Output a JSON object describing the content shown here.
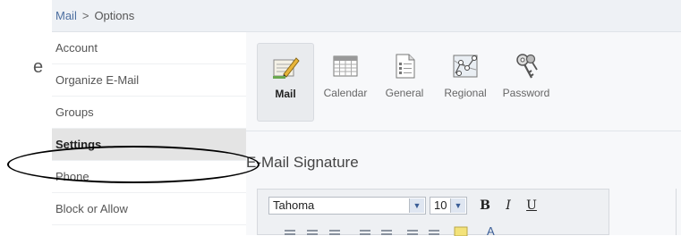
{
  "stray_text": "e",
  "breadcrumb": {
    "root": "Mail",
    "separator": ">",
    "current": "Options"
  },
  "sidebar": {
    "items": [
      {
        "label": "Account"
      },
      {
        "label": "Organize E-Mail"
      },
      {
        "label": "Groups"
      },
      {
        "label": "Settings",
        "selected": true
      },
      {
        "label": "Phone"
      },
      {
        "label": "Block or Allow"
      }
    ]
  },
  "options_toolbar": {
    "buttons": [
      {
        "label": "Mail",
        "icon": "mail-settings-icon",
        "active": true
      },
      {
        "label": "Calendar",
        "icon": "calendar-icon"
      },
      {
        "label": "General",
        "icon": "general-document-icon"
      },
      {
        "label": "Regional",
        "icon": "regional-map-icon"
      },
      {
        "label": "Password",
        "icon": "keys-icon"
      }
    ]
  },
  "signature": {
    "title": "E-Mail Signature",
    "font": "Tahoma",
    "size": "10",
    "bold": "B",
    "italic": "I",
    "underline": "U"
  },
  "colors": {
    "accent": "#4d6fa0",
    "selected_bg": "#e4e4e4",
    "breadcrumb_bg": "#eef1f5"
  }
}
